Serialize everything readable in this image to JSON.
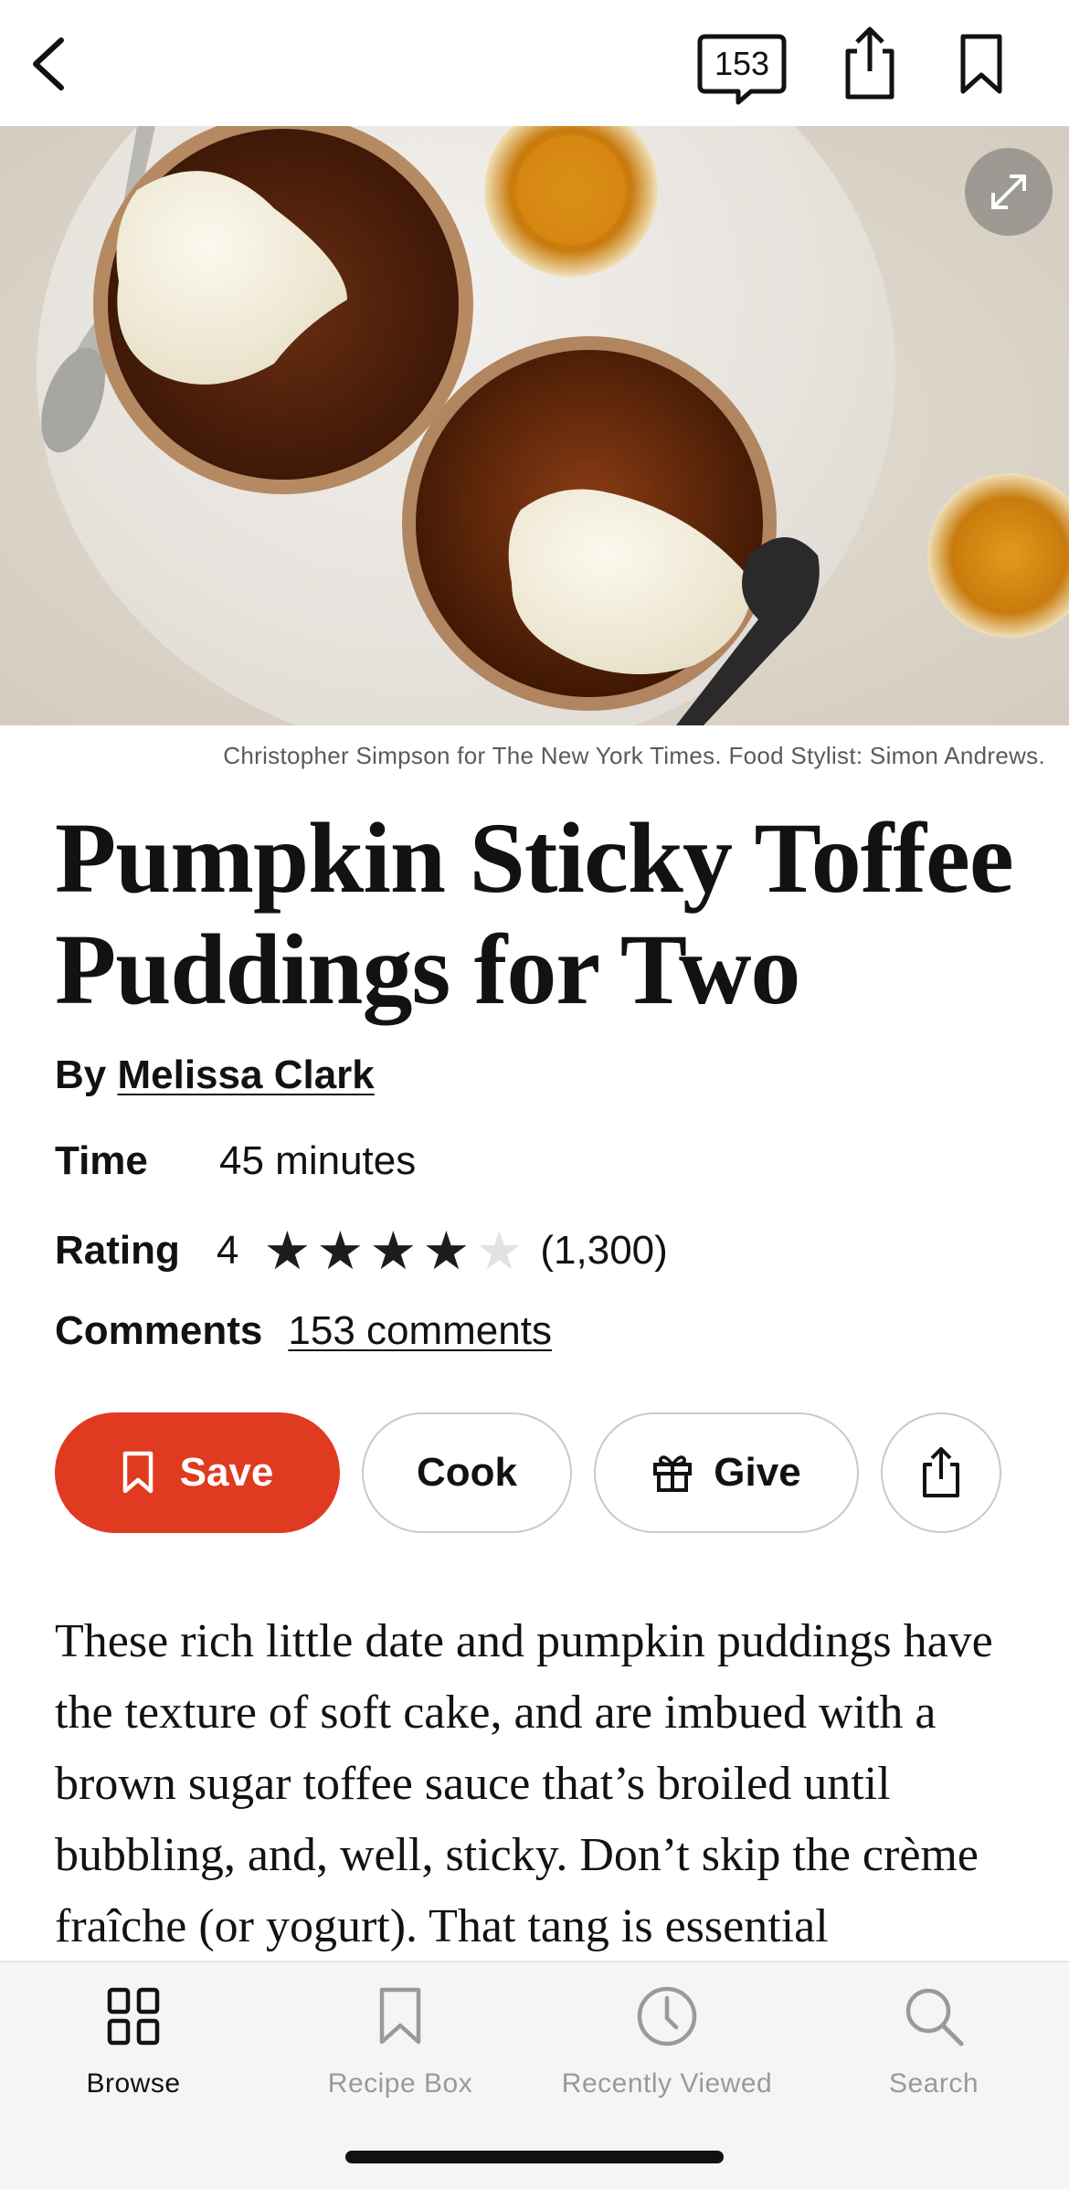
{
  "topbar": {
    "back_icon": "chevron-left-icon",
    "comment_count": "153",
    "share_icon": "share-icon",
    "bookmark_icon": "bookmark-icon"
  },
  "hero": {
    "expand_icon": "expand-icon"
  },
  "photo_credit": "Christopher Simpson for The New York Times. Food Stylist: Simon Andrews.",
  "recipe": {
    "title": "Pumpkin Sticky Toffee Puddings for Two",
    "by_prefix": "By",
    "author": "Melissa Clark",
    "time_label": "Time",
    "time_value": "45 minutes",
    "rating_label": "Rating",
    "rating_value": "4",
    "rating_stars": 4,
    "rating_max": 5,
    "rating_count": "(1,300)",
    "comments_label": "Comments",
    "comments_link": "153 comments"
  },
  "actions": {
    "save_label": "Save",
    "cook_label": "Cook",
    "give_label": "Give"
  },
  "description": "These rich little date and pumpkin puddings have the texture of soft cake, and are imbued with a brown sugar toffee sauce that’s broiled until bubbling, and, well, sticky. Don’t skip the crème fraîche (or yogurt). That tang is essential",
  "tabbar": {
    "tabs": [
      {
        "label": "Browse",
        "icon": "grid-icon",
        "active": true
      },
      {
        "label": "Recipe Box",
        "icon": "bookmark-icon",
        "active": false
      },
      {
        "label": "Recently Viewed",
        "icon": "clock-icon",
        "active": false
      },
      {
        "label": "Search",
        "icon": "search-icon",
        "active": false
      }
    ]
  },
  "colors": {
    "save_button": "#e03a21",
    "text": "#121212",
    "inactive_tab": "#9a9a9a"
  }
}
